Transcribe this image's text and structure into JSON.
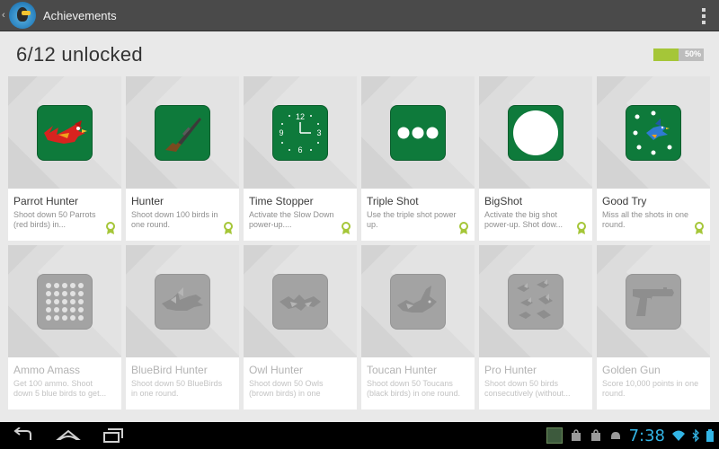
{
  "actionbar": {
    "title": "Achievements"
  },
  "summary": {
    "unlocked_text": "6/12 unlocked",
    "progress_label": "50%",
    "progress_fraction": 0.5
  },
  "achievements": [
    {
      "title": "Parrot Hunter",
      "desc": "Shoot down 50 Parrots (red birds) in...",
      "unlocked": true,
      "icon": "red-parrot-icon"
    },
    {
      "title": "Hunter",
      "desc": "Shoot down 100 birds in one round.",
      "unlocked": true,
      "icon": "rifle-icon"
    },
    {
      "title": "Time Stopper",
      "desc": "Activate the Slow Down power-up....",
      "unlocked": true,
      "icon": "clock-icon"
    },
    {
      "title": "Triple Shot",
      "desc": "Use the triple shot power up.",
      "unlocked": true,
      "icon": "triple-dots-icon"
    },
    {
      "title": "BigShot",
      "desc": "Activate the big shot power-up. Shot dow...",
      "unlocked": true,
      "icon": "big-circle-icon"
    },
    {
      "title": "Good Try",
      "desc": "Miss all the shots in one round.",
      "unlocked": true,
      "icon": "bluebird-target-icon"
    },
    {
      "title": "Ammo Amass",
      "desc": "Get 100 ammo. Shoot down 5 blue birds to get...",
      "unlocked": false,
      "icon": "ammo-grid-icon"
    },
    {
      "title": "BlueBird Hunter",
      "desc": "Shoot down 50 BlueBirds in one round.",
      "unlocked": false,
      "icon": "bluebird-icon"
    },
    {
      "title": "Owl Hunter",
      "desc": "Shoot down 50 Owls (brown birds) in one",
      "unlocked": false,
      "icon": "owl-icon"
    },
    {
      "title": "Toucan Hunter",
      "desc": "Shoot down 50 Toucans (black birds) in one round.",
      "unlocked": false,
      "icon": "toucan-icon"
    },
    {
      "title": "Pro Hunter",
      "desc": "Shoot down 50 birds consecutively (without...",
      "unlocked": false,
      "icon": "bird-flock-icon"
    },
    {
      "title": "Golden Gun",
      "desc": "Score 10,000 points in one round.",
      "unlocked": false,
      "icon": "pistol-icon"
    }
  ],
  "statusbar": {
    "time": "7:38"
  },
  "colors": {
    "badge_unlocked": "#0e7a3b",
    "badge_locked": "#a3a3a3",
    "progress_fill": "#a5c638",
    "clock": "#33b5e5"
  }
}
